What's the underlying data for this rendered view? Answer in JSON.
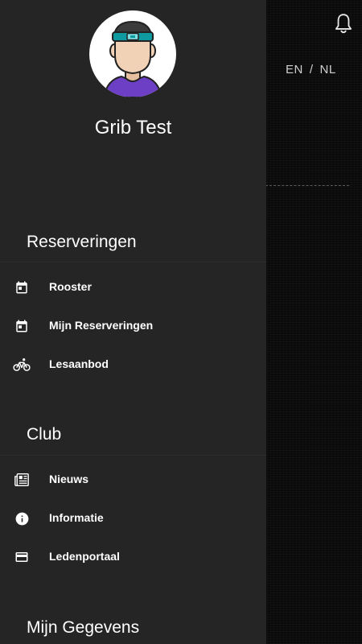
{
  "header": {
    "language": {
      "en": "EN",
      "separator": "/",
      "nl": "NL"
    }
  },
  "user": {
    "name": "Grib Test"
  },
  "sections": {
    "reserveringen": {
      "title": "Reserveringen",
      "items": [
        {
          "label": "Rooster",
          "icon": "calendar-icon"
        },
        {
          "label": "Mijn Reserveringen",
          "icon": "calendar-icon"
        },
        {
          "label": "Lesaanbod",
          "icon": "bicycle-icon"
        }
      ]
    },
    "club": {
      "title": "Club",
      "items": [
        {
          "label": "Nieuws",
          "icon": "newspaper-icon"
        },
        {
          "label": "Informatie",
          "icon": "info-icon"
        },
        {
          "label": "Ledenportaal",
          "icon": "credit-card-icon"
        }
      ]
    },
    "mijn_gegevens": {
      "title": "Mijn Gegevens"
    }
  },
  "colors": {
    "drawer_background": "#252525",
    "app_background": "#0a0a0a",
    "text": "#ffffff",
    "avatar_headband": "#0f9aa0",
    "avatar_shirt": "#6c3fc4",
    "avatar_skin": "#f2d2b6"
  }
}
